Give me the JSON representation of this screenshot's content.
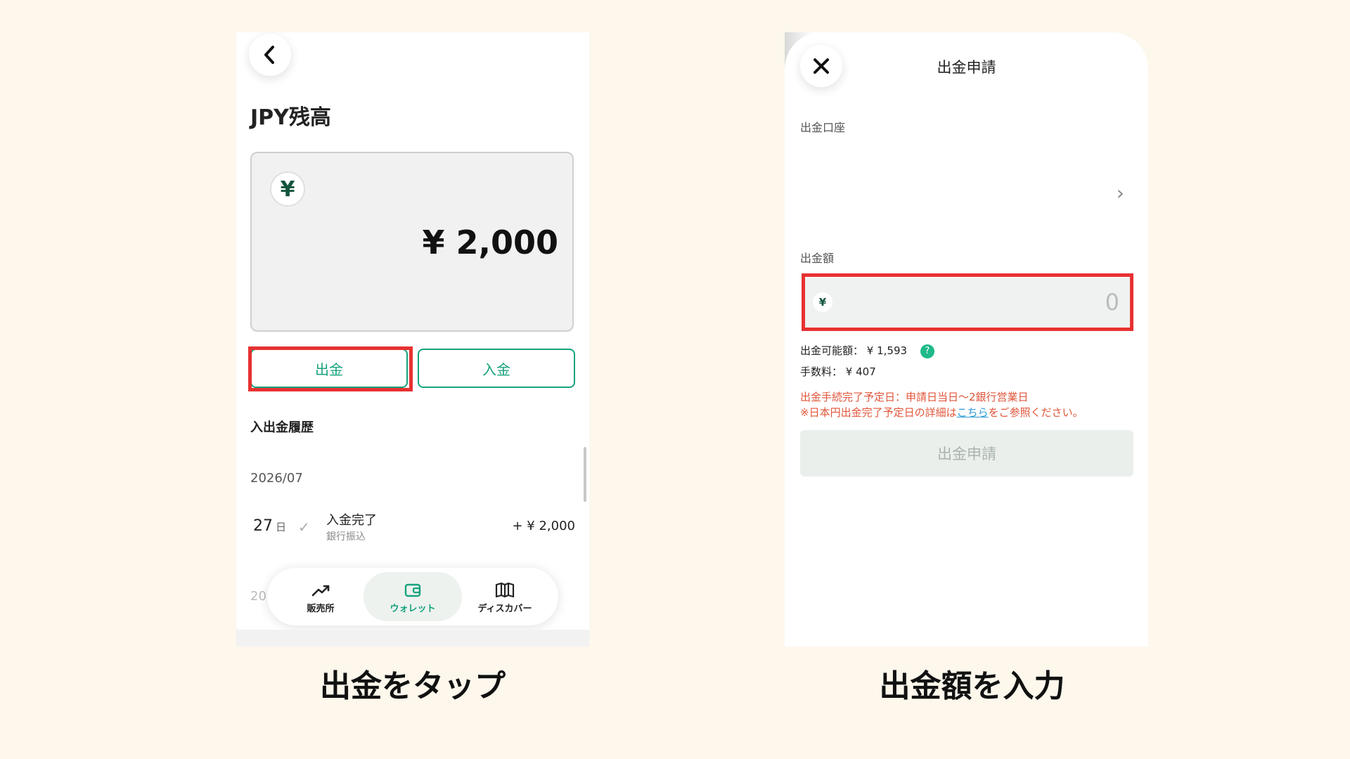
{
  "left_screen": {
    "back_icon": "chevron-left-icon",
    "title": "JPY残高",
    "balance_currency_symbol": "¥",
    "balance_amount": "¥ 2,000",
    "withdraw_label": "出金",
    "deposit_label": "入金",
    "history_title": "入出金履歴",
    "history_month": "2026/07",
    "transaction": {
      "day": "27",
      "day_unit": "日",
      "status": "入金完了",
      "method": "銀行振込",
      "amount": "+ ¥ 2,000"
    },
    "next_month_partial": "20",
    "nav": [
      {
        "label": "販売所",
        "icon": "trending-up-icon"
      },
      {
        "label": "ウォレット",
        "icon": "wallet-icon"
      },
      {
        "label": "ディスカバー",
        "icon": "book-map-icon"
      }
    ]
  },
  "right_screen": {
    "title": "出金申請",
    "account_label": "出金口座",
    "amount_label": "出金額",
    "amount_currency": "¥",
    "amount_value": "0",
    "available_label": "出金可能額：",
    "available_amount": "¥ 1,593",
    "fee_label": "手数料：",
    "fee_amount": "¥ 407",
    "notice_line1": "出金手続完了予定日：申請日当日〜2銀行営業日",
    "notice_line2_prefix": "※日本円出金完了予定日の詳細は",
    "notice_link": "こちら",
    "notice_line2_suffix": "をご参照ください。",
    "submit_label": "出金申請"
  },
  "captions": {
    "left": "出金をタップ",
    "right": "出金額を入力"
  },
  "colors": {
    "accent": "#16a37c",
    "highlight": "#e73131",
    "background": "#fdf7ec",
    "notice": "#e0553a",
    "link": "#2c9bd6"
  }
}
